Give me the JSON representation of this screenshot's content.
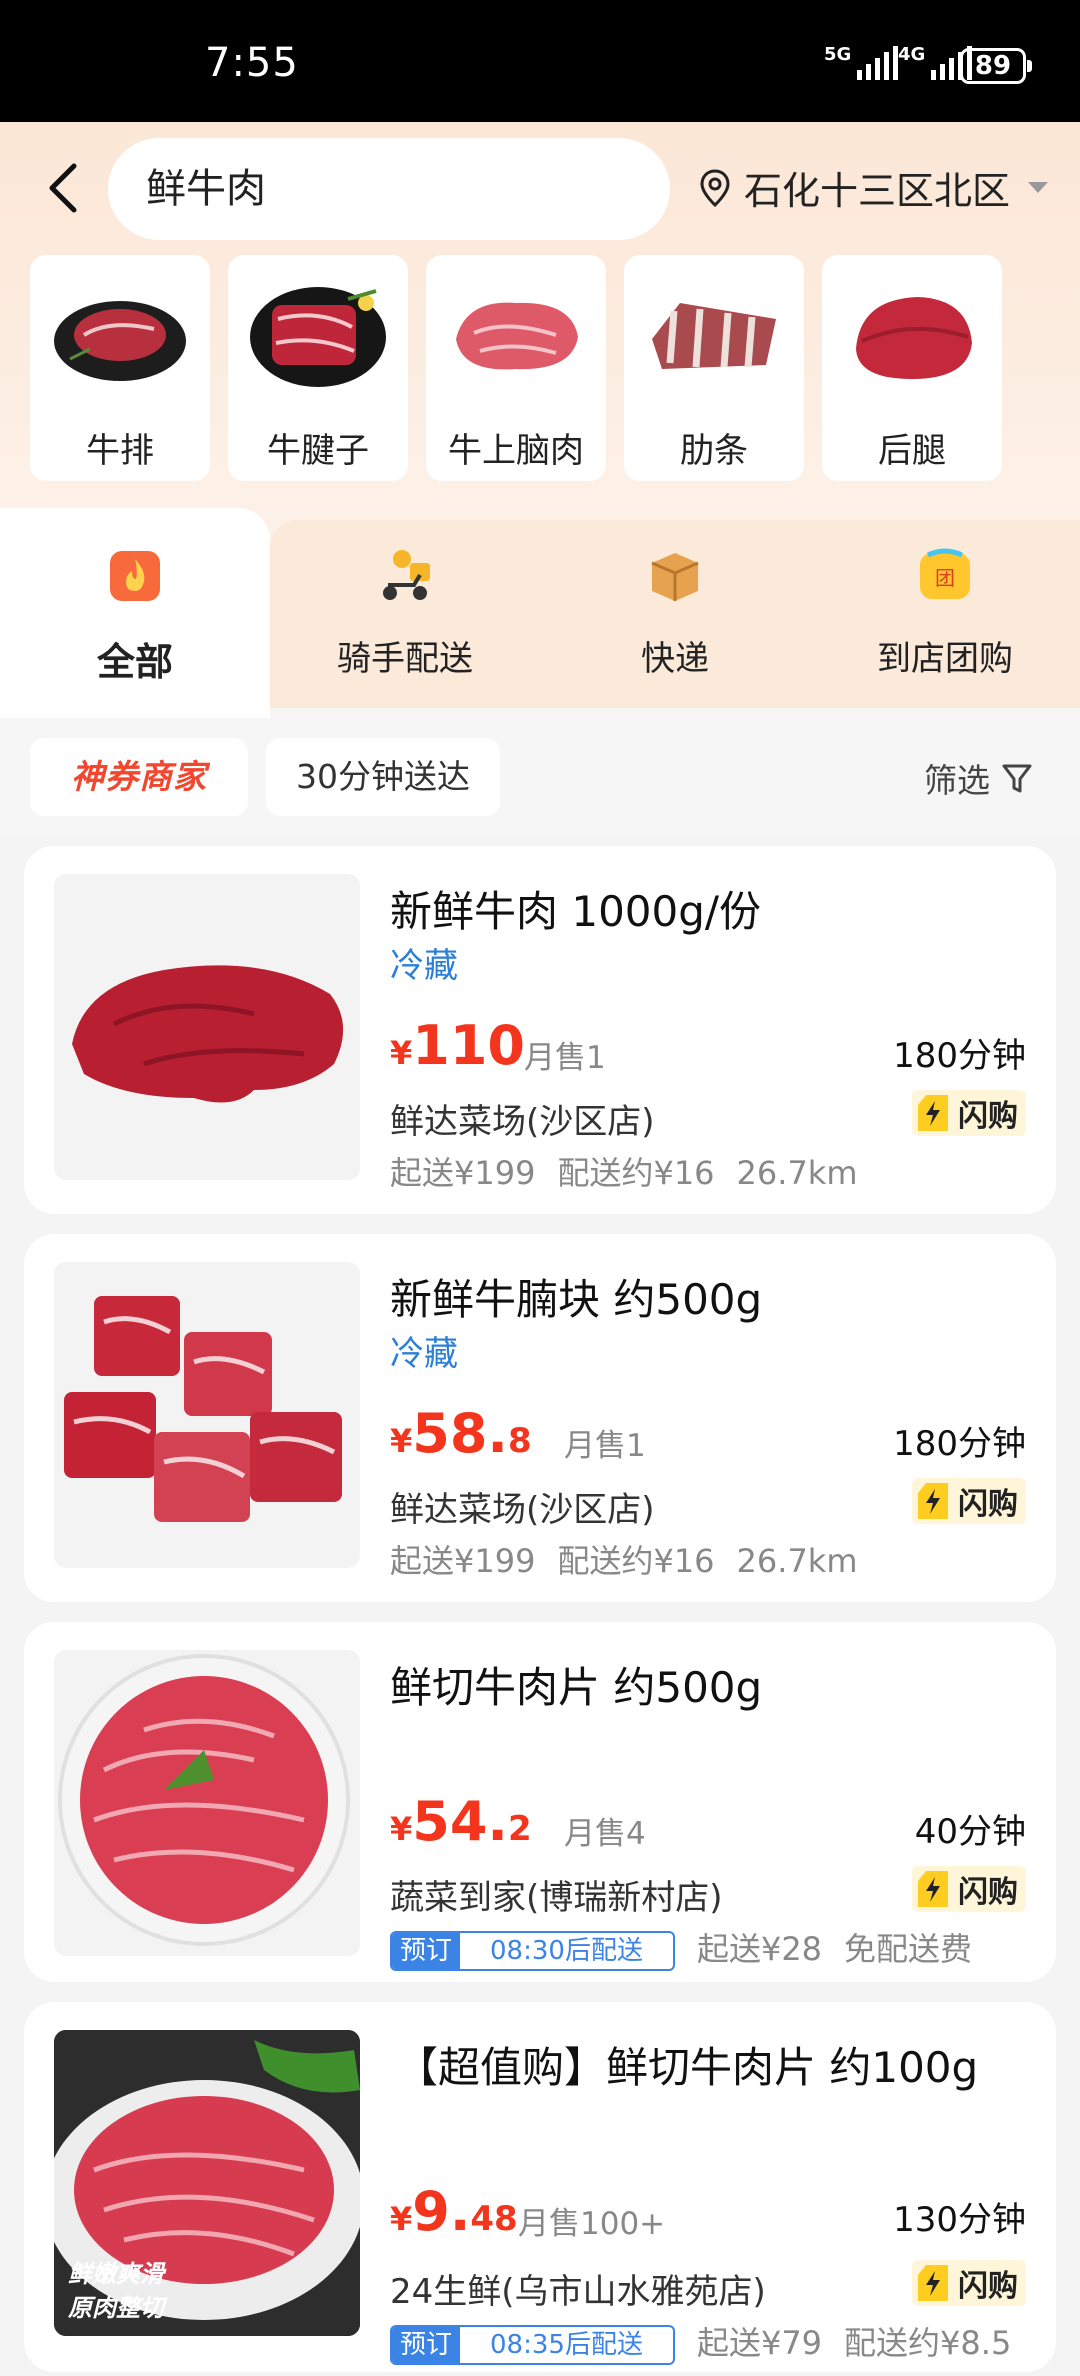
{
  "status_bar": {
    "time": "7:55",
    "signal_1": "5G",
    "signal_2": "4G",
    "battery": "89"
  },
  "search": {
    "query": "鲜牛肉",
    "location": "石化十三区北区"
  },
  "categories": [
    {
      "label": "牛排"
    },
    {
      "label": "牛腱子"
    },
    {
      "label": "牛上脑肉"
    },
    {
      "label": "肋条"
    },
    {
      "label": "后腿"
    }
  ],
  "tabs": [
    {
      "label": "全部"
    },
    {
      "label": "骑手配送"
    },
    {
      "label": "快递"
    },
    {
      "label": "到店团购"
    }
  ],
  "filters": {
    "promo_chip": "神券商家",
    "time_chip": "30分钟送达",
    "filter_label": "筛选"
  },
  "products": [
    {
      "title": "新鲜牛肉 1000g/份",
      "tag": "冷藏",
      "price_symbol": "¥",
      "price_int": "110",
      "price_dec": "",
      "sales": "月售1",
      "eta": "180分钟",
      "store": "鲜达菜场(沙区店)",
      "flash": "闪购",
      "min_order": "起送¥199",
      "delivery": "配送约¥16",
      "distance": "26.7km"
    },
    {
      "title": "新鲜牛腩块 约500g",
      "tag": "冷藏",
      "price_symbol": "¥",
      "price_int": "58.",
      "price_dec": "8",
      "sales": "月售1",
      "eta": "180分钟",
      "store": "鲜达菜场(沙区店)",
      "flash": "闪购",
      "min_order": "起送¥199",
      "delivery": "配送约¥16",
      "distance": "26.7km"
    },
    {
      "title": "鲜切牛肉片 约500g",
      "tag": "",
      "price_symbol": "¥",
      "price_int": "54.",
      "price_dec": "2",
      "sales": "月售4",
      "eta": "40分钟",
      "store": "蔬菜到家(博瑞新村店)",
      "flash": "闪购",
      "preorder_label": "预订",
      "preorder_time": "08:30后配送",
      "min_order": "起送¥28",
      "delivery": "免配送费"
    },
    {
      "title": "【超值购】鲜切牛肉片 约100g",
      "tag": "",
      "price_symbol": "¥",
      "price_int": "9.",
      "price_dec": "48",
      "sales": "月售100+",
      "eta": "130分钟",
      "store": "24生鲜(乌市山水雅苑店)",
      "flash": "闪购",
      "preorder_label": "预订",
      "preorder_time": "08:35后配送",
      "min_order": "起送¥79",
      "delivery": "配送约¥8.5",
      "photo_caption_1": "鲜嫩爽滑",
      "photo_caption_2": "原肉整切"
    }
  ],
  "colors": {
    "price_red": "#f3351e",
    "tag_blue": "#2c7fd8",
    "header_peach": "#fbe7d6"
  }
}
